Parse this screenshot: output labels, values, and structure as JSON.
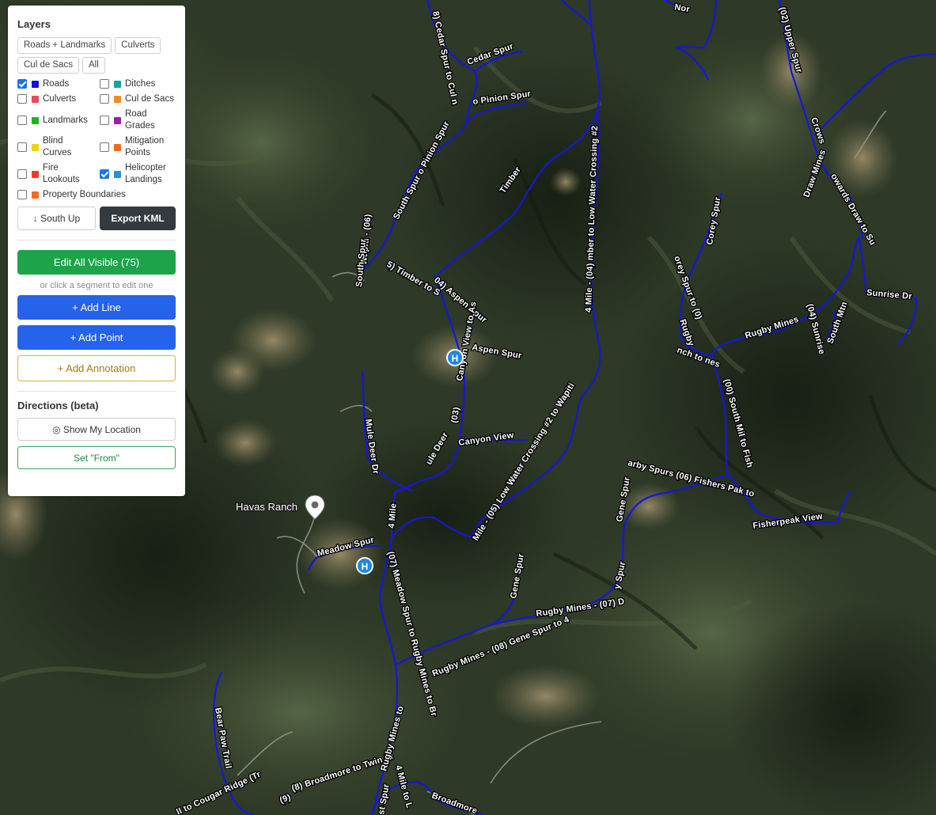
{
  "map": {
    "places": [
      {
        "name": "Havas Ranch",
        "icon": "map-pin-icon"
      }
    ],
    "markers": [
      {
        "label": "H",
        "type": "helicopter-landing"
      },
      {
        "label": "H",
        "type": "helicopter-landing"
      }
    ],
    "road_labels": [
      "8) Cedar Spur to Cul n",
      "Cedar Spur",
      "o Pinion Spur",
      "South Spur o Pinion Spur",
      "Wapiti - (06)",
      "South Spur",
      "5) Timber to S",
      "Timber",
      "04) Aspen Spur",
      "Aspen Spur",
      "Canyon View to As",
      "(03)",
      "ule Deer",
      "4 Mile",
      "Mule Deer Dr",
      "Canyon View",
      "Meadow Spur",
      "(07) Meadow Spur to Rugby Mines to Br",
      "Mile - (05) Low Water Crossing #2 to Wapiti",
      "4 Mile - (04) mber to Low Water Crossing #2",
      "Rugby Mines - (08) Gene Spur to 4",
      "Gene Spur",
      "Rugby Mines - (07) D",
      "y Spur",
      "Gene Spur",
      "arby Spurs (06) Fishers Pak to",
      "Fisherpeak View",
      "(00) South Mil to Fish",
      "Corey Spur",
      "orey Spur to (0)",
      "Rugby",
      "nch to nes",
      "Rugby Mines",
      "(04) Sunrise",
      "South Mtn",
      "Sunrise Dr",
      "(02) Upper Spur",
      "Crows",
      "Draw Mines",
      "owards Draw to Su",
      "(8) Broadmore to Twin Ri",
      "Rugby Mines to",
      "4 Mile to L",
      "Broadmore",
      "st Spur",
      "Bear Paw Trail",
      "ll to Cougar Ridge (Tr",
      "(9)",
      "Nor"
    ]
  },
  "panel": {
    "title": "Layers",
    "presets": [
      "Roads + Landmarks",
      "Culverts",
      "Cul de Sacs",
      "All"
    ],
    "layers": [
      {
        "label": "Roads",
        "color": "#1010e0",
        "checked": true
      },
      {
        "label": "Ditches",
        "color": "#12a3a3",
        "checked": false
      },
      {
        "label": "Culverts",
        "color": "#f04a5a",
        "checked": false
      },
      {
        "label": "Cul de Sacs",
        "color": "#f5891f",
        "checked": false
      },
      {
        "label": "Landmarks",
        "color": "#19b32a",
        "checked": false
      },
      {
        "label": "Road Grades",
        "color": "#a01fa8",
        "checked": false
      },
      {
        "label": "Blind Curves",
        "color": "#f2d20c",
        "checked": false
      },
      {
        "label": "Mitigation Points",
        "color": "#f26a1f",
        "checked": false
      },
      {
        "label": "Fire Lookouts",
        "color": "#f03c1e",
        "checked": false
      },
      {
        "label": "Helicopter Landings",
        "color": "#1e90e8",
        "checked": true
      },
      {
        "label": "Property Boundaries",
        "color": "#f26a1f",
        "checked": false
      }
    ],
    "south_up_label": "↓ South Up",
    "export_label": "Export KML",
    "edit_all_label": "Edit All Visible (75)",
    "hint": "or click a segment to edit one",
    "add_line_label": "+ Add Line",
    "add_point_label": "+ Add Point",
    "add_annotation_label": "+ Add Annotation",
    "directions_title": "Directions (beta)",
    "show_location_label": "◎ Show My Location",
    "set_from_label": "Set \"From\""
  }
}
